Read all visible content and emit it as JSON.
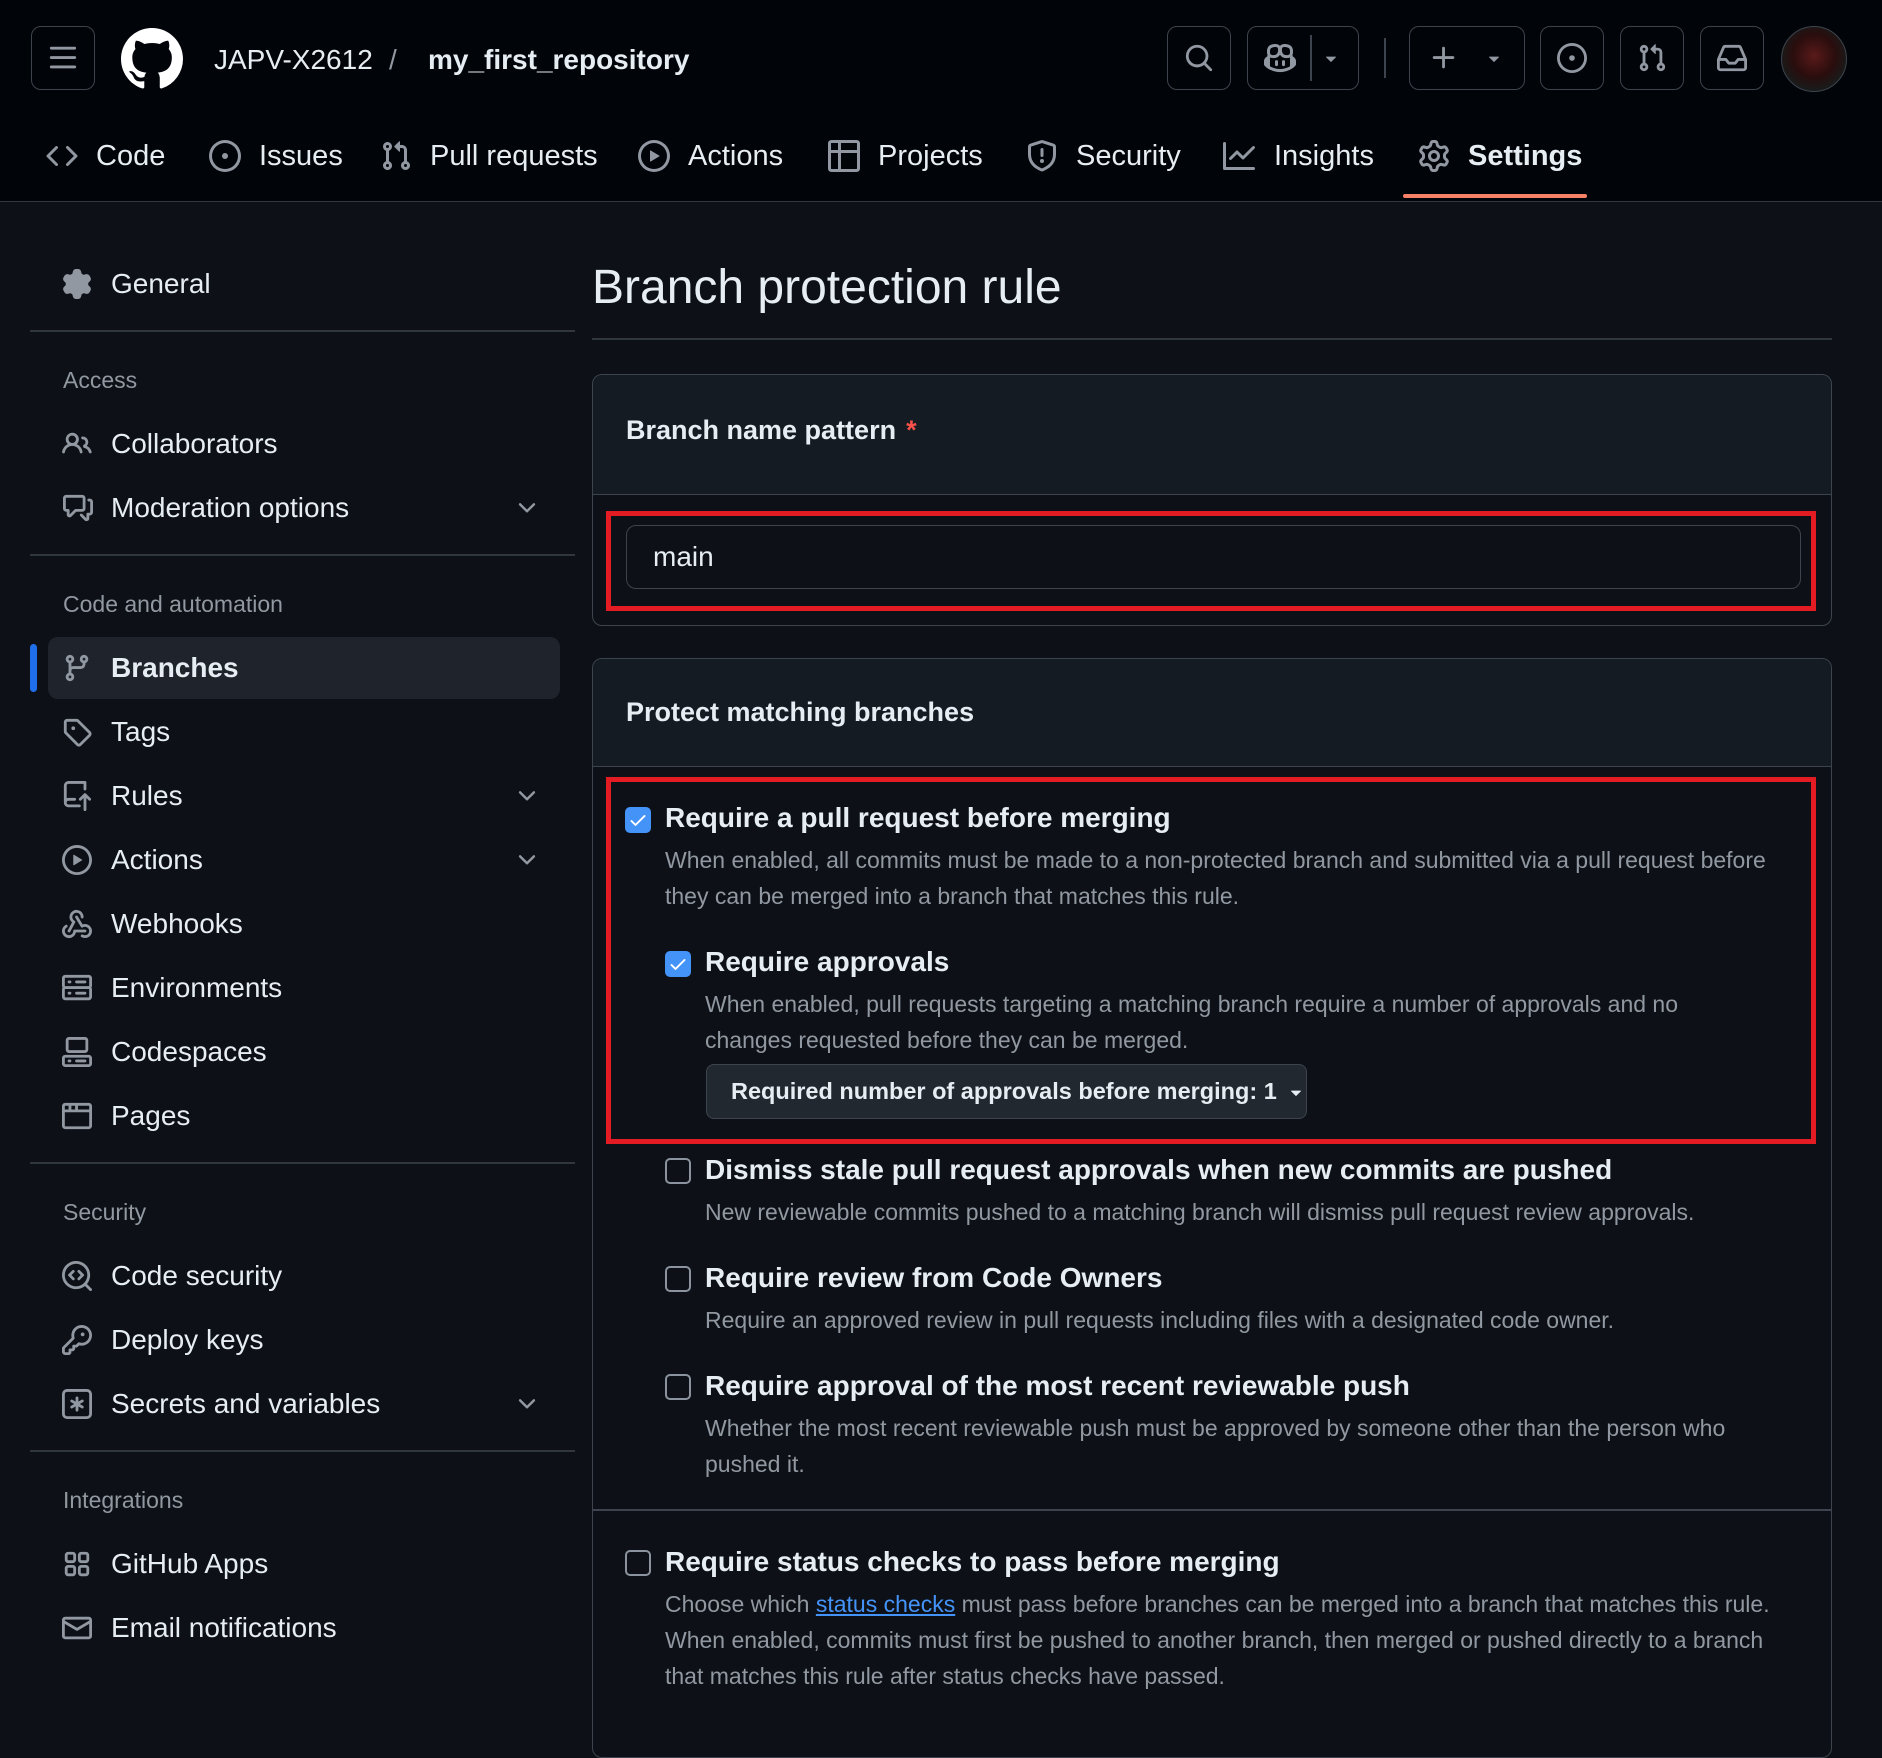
{
  "header": {
    "owner": "JAPV-X2612",
    "separator": "/",
    "repo": "my_first_repository"
  },
  "tabs": [
    {
      "label": "Code",
      "icon": "code-icon"
    },
    {
      "label": "Issues",
      "icon": "issue-opened-icon"
    },
    {
      "label": "Pull requests",
      "icon": "git-pull-request-icon"
    },
    {
      "label": "Actions",
      "icon": "play-icon"
    },
    {
      "label": "Projects",
      "icon": "table-icon"
    },
    {
      "label": "Security",
      "icon": "shield-icon"
    },
    {
      "label": "Insights",
      "icon": "graph-icon"
    },
    {
      "label": "Settings",
      "icon": "gear-icon",
      "active": true
    }
  ],
  "sidebar": {
    "general": "General",
    "access_heading": "Access",
    "collaborators": "Collaborators",
    "moderation": "Moderation options",
    "code_heading": "Code and automation",
    "branches": "Branches",
    "tags": "Tags",
    "rules": "Rules",
    "actions": "Actions",
    "webhooks": "Webhooks",
    "environments": "Environments",
    "codespaces": "Codespaces",
    "pages": "Pages",
    "security_heading": "Security",
    "code_security": "Code security",
    "deploy_keys": "Deploy keys",
    "secrets": "Secrets and variables",
    "integrations_heading": "Integrations",
    "github_apps": "GitHub Apps",
    "email_notifications": "Email notifications"
  },
  "main": {
    "title": "Branch protection rule",
    "pattern_label": "Branch name pattern",
    "required_marker": "*",
    "pattern_value": "main",
    "protect_heading": "Protect matching branches",
    "options": {
      "require_pr": {
        "title": "Require a pull request before merging",
        "desc": "When enabled, all commits must be made to a non-protected branch and submitted via a pull request before they can be merged into a branch that matches this rule.",
        "checked": true
      },
      "require_approvals": {
        "title": "Require approvals",
        "desc": "When enabled, pull requests targeting a matching branch require a number of approvals and no changes requested before they can be merged.",
        "checked": true,
        "select_label": "Required number of approvals before merging: 1"
      },
      "dismiss_stale": {
        "title": "Dismiss stale pull request approvals when new commits are pushed",
        "desc": "New reviewable commits pushed to a matching branch will dismiss pull request review approvals.",
        "checked": false
      },
      "code_owners": {
        "title": "Require review from Code Owners",
        "desc": "Require an approved review in pull requests including files with a designated code owner.",
        "checked": false
      },
      "recent_push": {
        "title": "Require approval of the most recent reviewable push",
        "desc": "Whether the most recent reviewable push must be approved by someone other than the person who pushed it.",
        "checked": false
      },
      "status_checks": {
        "title": "Require status checks to pass before merging",
        "desc_pre": "Choose which ",
        "desc_link": "status checks",
        "desc_post": " must pass before branches can be merged into a branch that matches this rule. When enabled, commits must first be pushed to another branch, then merged or pushed directly to a branch that matches this rule after status checks have passed.",
        "checked": false
      }
    }
  },
  "colors": {
    "background": "#0d1117",
    "header_bg": "#010409",
    "accent_blue": "#4493f8",
    "tab_underline": "#f78166",
    "highlight_red": "#e31c24"
  }
}
